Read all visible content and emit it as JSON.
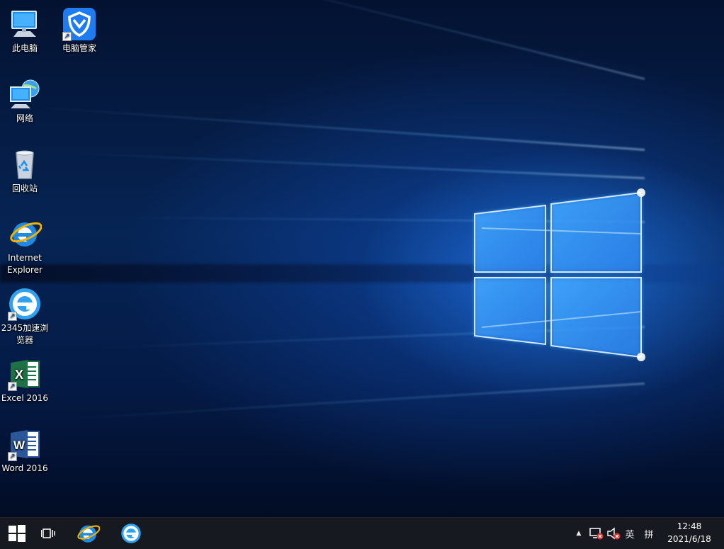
{
  "desktop_icons": [
    {
      "label": "此电脑",
      "icon": "this-pc-icon"
    },
    {
      "label": "电脑管家",
      "icon": "pc-manager-icon",
      "shortcut": true
    },
    {
      "label": "网络",
      "icon": "network-icon"
    },
    {
      "label": "回收站",
      "icon": "recycle-bin-icon"
    },
    {
      "label": "Internet Explorer",
      "label_lines": [
        "Internet",
        "Explorer"
      ],
      "icon": "internet-explorer-icon"
    },
    {
      "label": "2345加速浏览器",
      "label_lines": [
        "2345加速浏",
        "览器"
      ],
      "icon": "2345-browser-icon",
      "shortcut": true
    },
    {
      "label": "Excel 2016",
      "icon": "excel-icon",
      "shortcut": true
    },
    {
      "label": "Word 2016",
      "icon": "word-icon",
      "shortcut": true
    }
  ],
  "taskbar": {
    "start_icon": "windows-start-icon",
    "task_view_icon": "task-view-icon",
    "pinned": [
      {
        "name": "Internet Explorer",
        "icon": "internet-explorer-icon"
      },
      {
        "name": "2345加速浏览器",
        "icon": "2345-browser-icon"
      }
    ],
    "tray": {
      "chevron": "▲",
      "network_icon": "network-disconnected-icon",
      "volume_icon": "volume-muted-icon",
      "input_language": "英",
      "ime_mode": "拼"
    },
    "clock": {
      "time": "12:48",
      "date": "2021/6/18"
    }
  },
  "colors": {
    "taskbar": "#161a20",
    "desktop_accent": "#1e7bff",
    "ie_blue": "#1f8ae0",
    "ie_gold": "#f2b200",
    "excel_green": "#1e7145",
    "word_blue": "#2b579a",
    "pcmgr_blue": "#1f7cf0"
  }
}
